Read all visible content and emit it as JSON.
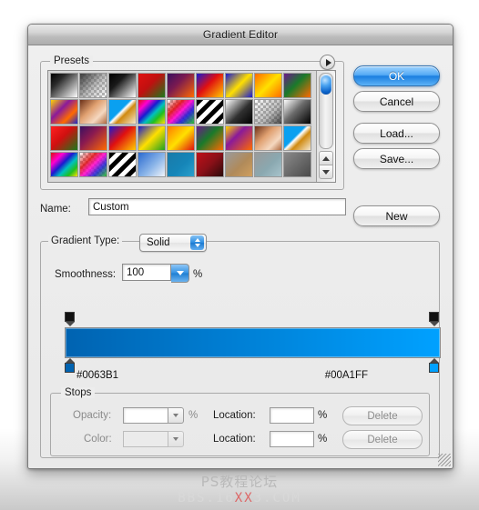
{
  "window": {
    "title": "Gradient Editor"
  },
  "presets": {
    "group_title": "Presets",
    "menu_icon": "disclosure-triangle-icon",
    "scrollbar": {
      "up_icon": "scroll-up-arrow-icon",
      "down_icon": "scroll-down-arrow-icon"
    },
    "swatches": [
      {
        "name": "black-white",
        "css": "linear-gradient(135deg,#000000 0%,#2a2a2a 30%,#ffffff 100%)"
      },
      {
        "name": "foreground-to-transparent",
        "checker": true,
        "css": "linear-gradient(135deg,#3a3a3a 0%,rgba(140,140,140,0.55) 55%,rgba(255,255,255,0) 100%)"
      },
      {
        "name": "black-white-2",
        "css": "linear-gradient(135deg,#000000 0%,#1a1a1a 35%,#ffffff 100%)"
      },
      {
        "name": "red-green",
        "css": "linear-gradient(135deg,#e01010 0%,#c01010 45%,#1a7a1a 100%)"
      },
      {
        "name": "violet-orange",
        "css": "linear-gradient(135deg,#3a1060 0%,#7a1a50 40%,#ff6a00 100%)"
      },
      {
        "name": "blue-red-yellow",
        "css": "linear-gradient(135deg,#1a1ad0 0%,#e01010 45%,#ffcc00 100%)"
      },
      {
        "name": "blue-yellow-blue",
        "css": "linear-gradient(135deg,#1a1ad0 0%,#ffe000 50%,#1a1ad0 100%)"
      },
      {
        "name": "orange-yellow-orange",
        "css": "linear-gradient(135deg,#ff6a00 0%,#ffe000 50%,#ff6a00 100%)"
      },
      {
        "name": "violet-green-orange",
        "css": "linear-gradient(135deg,#6a1a8a 0%,#1a7a2a 45%,#ff6a00 100%)"
      },
      {
        "name": "yellow-violet-orange-blue",
        "css": "linear-gradient(135deg,#ffd400 0%,#8a1a9a 38%,#ff6a00 70%,#1a2ad0 100%)"
      },
      {
        "name": "copper",
        "css": "linear-gradient(135deg,#6a3018 0%,#e0a070 40%,#f5d8c0 70%,#b06a40 100%)"
      },
      {
        "name": "blue-orange-diagonal",
        "css": "linear-gradient(135deg,#0aa0f0 0%,#0aa0f0 42%,#ffffff 48%,#d08a10 60%,#f5e8d0 100%)"
      },
      {
        "name": "spectrum",
        "css": "linear-gradient(135deg,#e01010 0%,#ff00d0 22%,#1a1ad0 42%,#00c0c0 58%,#20c020 74%,#ffe000 100%)"
      },
      {
        "name": "transparent-rainbow",
        "checker": true,
        "css": "linear-gradient(135deg,rgba(255,255,255,0) 0%,rgba(224,16,16,0.9) 30%,rgba(255,0,208,0.9) 50%,rgba(26,26,208,0.9) 70%,rgba(32,192,32,0.9) 100%)"
      },
      {
        "name": "black-white-stripes",
        "css": "repeating-linear-gradient(135deg,#000 0 5px,#fff 5px 10px)"
      },
      {
        "name": "black-white-3",
        "css": "linear-gradient(135deg,#ffffff 0%,#303030 55%,#000000 100%)"
      },
      {
        "name": "transparent-stripe",
        "checker": true,
        "css": "linear-gradient(135deg,rgba(255,255,255,0) 0%,rgba(120,120,120,0.5) 60%,rgba(40,40,40,0.85) 100%)"
      },
      {
        "name": "white-black",
        "css": "linear-gradient(135deg,#ffffff 0%,#6a6a6a 45%,#000000 100%)"
      },
      {
        "name": "red-green-2",
        "css": "linear-gradient(135deg,#ff2020 0%,#d01010 45%,#1a7a1a 100%)"
      },
      {
        "name": "violet-orange-2",
        "css": "linear-gradient(135deg,#3a1060 0%,#8a1a50 40%,#ff6a00 100%)"
      },
      {
        "name": "blue-red-yellow-2",
        "css": "linear-gradient(135deg,#1a1ad0 0%,#e01010 45%,#ffcc00 100%)"
      },
      {
        "name": "blue-yellow-green",
        "css": "linear-gradient(135deg,#1a1ad0 0%,#ffe000 50%,#20a020 100%)"
      },
      {
        "name": "orange-yellow-red",
        "css": "linear-gradient(135deg,#ff7a00 0%,#ffe000 50%,#e01010 100%)"
      },
      {
        "name": "violet-green-orange-2",
        "css": "linear-gradient(135deg,#6a1a8a 0%,#1a7a2a 45%,#ff6a00 100%)"
      },
      {
        "name": "yellow-violet-orange",
        "css": "linear-gradient(135deg,#ffd400 0%,#8a1a9a 40%,#ff6a00 100%)"
      },
      {
        "name": "copper-2",
        "css": "linear-gradient(135deg,#6a3018 0%,#e0a070 40%,#f5d8c0 72%,#b06a40 100%)"
      },
      {
        "name": "blue-orange-diagonal-2",
        "css": "linear-gradient(135deg,#0aa0f0 0%,#0aa0f0 42%,#ffffff 48%,#d08a10 62%,#f5e8d0 100%)"
      },
      {
        "name": "spectrum-2",
        "css": "linear-gradient(135deg,#e01010 0%,#ff00d0 25%,#1a1ad0 45%,#00c0c0 62%,#20c020 80%,#ffe000 100%)"
      },
      {
        "name": "transparent-rainbow-2",
        "checker": true,
        "css": "linear-gradient(135deg,rgba(255,255,255,0) 0%,rgba(224,16,16,0.85) 32%,rgba(255,0,208,0.85) 52%,rgba(26,26,208,0.85) 72%,rgba(32,192,32,0.85) 100%)"
      },
      {
        "name": "black-white-stripes-2",
        "css": "repeating-linear-gradient(135deg,#000 0 5px,#fff 5px 10px)"
      },
      {
        "name": "blue-white",
        "css": "linear-gradient(135deg,#2a6ad0 0%,#8ab4e8 55%,#f0f4fa 100%)"
      },
      {
        "name": "steel-blue",
        "css": "linear-gradient(135deg,#1a7aa8 0%,#1585b8 55%,#2aa0cc 100%)"
      },
      {
        "name": "red-black",
        "css": "linear-gradient(135deg,#c01018 0%,#8a1018 50%,#2a0a0a 100%)"
      },
      {
        "name": "gray-orange",
        "css": "linear-gradient(135deg,#9a9a9a 0%,#b08a5a 55%,#d0a060 100%)"
      },
      {
        "name": "gray-teal",
        "css": "linear-gradient(135deg,#9a9a9a 0%,#8aa8b0 55%,#a8c4cc 100%)"
      },
      {
        "name": "gray-gradient",
        "css": "linear-gradient(135deg,#8a8a8a 0%,#6a6a6a 50%,#4a4a4a 100%)"
      }
    ]
  },
  "buttons": {
    "ok": "OK",
    "cancel": "Cancel",
    "load": "Load...",
    "save": "Save...",
    "new": "New"
  },
  "name_row": {
    "label": "Name:",
    "value": "Custom"
  },
  "gradient_type": {
    "label": "Gradient Type:",
    "value": "Solid",
    "stepper_icon": "stepper-up-down-icon"
  },
  "smoothness": {
    "label": "Smoothness:",
    "value": "100",
    "unit": "%",
    "arrow_icon": "chevron-down-icon"
  },
  "gradient": {
    "start_hex": "#0063B1",
    "end_hex": "#00A1FF",
    "opacity_stop_icon": "opacity-stop-marker-icon",
    "color_stop_icon": "color-stop-marker-icon"
  },
  "stops": {
    "group_title": "Stops",
    "opacity_label": "Opacity:",
    "opacity_value": "",
    "opacity_unit": "%",
    "color_label": "Color:",
    "location_label": "Location:",
    "location1_value": "",
    "location2_value": "",
    "location_unit": "%",
    "delete_label": "Delete"
  },
  "resize_grip_icon": "resize-grip-icon",
  "watermark": {
    "line1": "PS教程论坛",
    "line2_a": "BBS.16",
    "line2_b": "XX",
    "line2_c": "3.COM"
  }
}
